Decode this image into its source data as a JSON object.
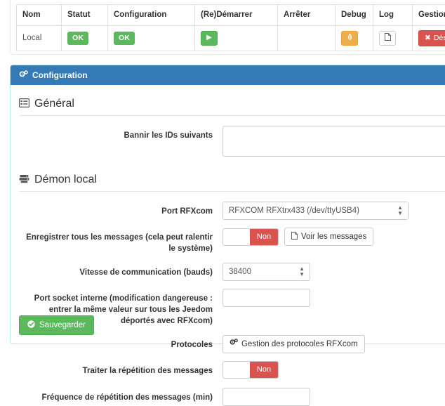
{
  "daemon_table": {
    "name": "daemon-status-table",
    "columns": [
      "Nom",
      "Statut",
      "Configuration",
      "(Re)Démarrer",
      "Arrêter",
      "Debug",
      "Log",
      "Gestion automatique"
    ],
    "rows": [
      {
        "nom": "Local",
        "statut": "OK",
        "configuration": "OK",
        "restart_icon": "play-icon",
        "stop": "",
        "debug_icon": "bug-icon",
        "log_icon": "file-icon",
        "gestion_auto": "Désactiver",
        "gestion_auto_icon": "times-icon"
      }
    ]
  },
  "config_panel": {
    "heading": "Configuration",
    "heading_icon": "gears-icon",
    "sections": {
      "general": {
        "legend": "Général",
        "legend_icon": "list-alt-icon",
        "fields": {
          "bannir_ids": {
            "label": "Bannir les IDs suivants",
            "value": "",
            "placeholder": ""
          }
        }
      },
      "demon_local": {
        "legend": "Démon local",
        "legend_icon": "server-icon",
        "fields": {
          "port_rfxcom": {
            "label": "Port RFXcom",
            "value": "RFXCOM RFXtrx433 (/dev/ttyUSB4)",
            "options": [
              "RFXCOM RFXtrx433 (/dev/ttyUSB4)"
            ]
          },
          "enregistrer_messages": {
            "label": "Enregistrer tous les messages (cela peut ralentir le système)",
            "toggle_value": "Non",
            "button_label": "Voir les messages",
            "button_icon": "file-icon"
          },
          "vitesse": {
            "label": "Vitesse de communication (bauds)",
            "value": "38400",
            "options": [
              "38400"
            ]
          },
          "port_socket": {
            "label": "Port socket interne (modification dangereuse : entrer la même valeur sur tous les Jeedom déportés avec RFXcom)",
            "value": "",
            "placeholder": ""
          },
          "protocoles": {
            "label": "Protocoles",
            "button_label": "Gestion des protocoles RFXcom",
            "button_icon": "gears-icon"
          },
          "repetition": {
            "label": "Traiter la répétition des messages",
            "toggle_value": "Non"
          },
          "frequence": {
            "label": "Fréquence de répétition des messages (min)",
            "value": "",
            "placeholder": ""
          }
        }
      }
    },
    "save_button": {
      "label": "Sauvegarder",
      "icon": "check-circle-icon"
    }
  },
  "colors": {
    "panel_header": "#337ab7",
    "success": "#5cb85c",
    "danger": "#d9534f",
    "warning": "#f0ad4e",
    "panel_border": "#bce8f1"
  }
}
